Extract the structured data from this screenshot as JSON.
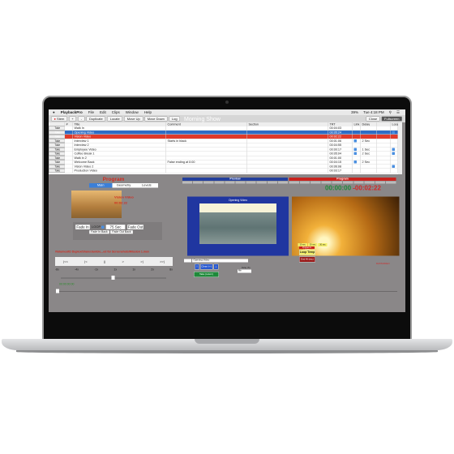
{
  "menubar": {
    "app": "PlaybackPro",
    "items": [
      "File",
      "Edit",
      "Clips",
      "Window",
      "Help"
    ],
    "battery": "39%",
    "clock": "Tue 4:18 PM"
  },
  "toolbar": {
    "items": [
      "Stem",
      "+",
      "-",
      "Duplicate",
      "Locate",
      "Move Up",
      "Move Down",
      "Log"
    ],
    "title": "Morning Show",
    "close": "Close",
    "fullscreen": "Fullscreen"
  },
  "table": {
    "headers": [
      "",
      "#",
      "Title",
      "Comment",
      "Section",
      "TRT",
      "Link",
      "Delay",
      "",
      "Loop"
    ],
    "take": "Take",
    "rows": [
      {
        "title": "Walk In",
        "comment": "",
        "trt": "00:04:03",
        "link": false,
        "delay": "",
        "loop": false
      },
      {
        "title": "Opening Video",
        "comment": "",
        "trt": "00:05:24",
        "link": false,
        "delay": "",
        "loop": true
      },
      {
        "title": "Vision Video",
        "comment": "",
        "trt": "00:02:22",
        "link": false,
        "delay": "",
        "loop": false
      },
      {
        "title": "Interview 1",
        "comment": "Starts in black",
        "trt": "00:01:06",
        "link": true,
        "delay": "2 Sec",
        "loop": false
      },
      {
        "title": "Interview 2",
        "comment": "",
        "trt": "00:04:55",
        "link": false,
        "delay": "",
        "loop": false
      },
      {
        "title": "Employee Video",
        "comment": "",
        "trt": "00:00:17",
        "link": true,
        "delay": "1 Sec",
        "loop": true
      },
      {
        "title": "Coffee Break 1",
        "comment": "",
        "trt": "00:05:04",
        "link": true,
        "delay": "2 Sec",
        "loop": true
      },
      {
        "title": "Walk in 2",
        "comment": "",
        "trt": "00:01:00",
        "link": false,
        "delay": "",
        "loop": false
      },
      {
        "title": "Welcome Back",
        "comment": "False ending at 0:00",
        "trt": "00:04:15",
        "link": true,
        "delay": "2 Sec",
        "loop": false
      },
      {
        "title": "Vision Video 2",
        "comment": "",
        "trt": "00:06:08",
        "link": false,
        "delay": "",
        "loop": true
      },
      {
        "title": "Production Video",
        "comment": "",
        "trt": "00:03:17",
        "link": false,
        "delay": "",
        "loop": false
      }
    ]
  },
  "program_panel": {
    "title": "Program",
    "tabs": [
      "Main",
      "Geometry",
      "Levels"
    ],
    "clip_name": "Vision Video",
    "clip_time": "00:02:22",
    "fade_in": "Fade In",
    "loop": "LOOP",
    "fade_time": "75 Sec",
    "fade_out": "Fade Out",
    "fade_in_back": "Fade In Back",
    "fade_out_back": "Fade Out Back",
    "path": "/Volumes/ID Duplex/Share/Jumble...ed for Screenshots/Mission 1.mov",
    "transport": [
      "|<<",
      "|<",
      "||",
      ">",
      ">|",
      ">>|"
    ],
    "speeds": [
      "-8x",
      "-4x",
      "-1x",
      "1x",
      "1x",
      "2x",
      "8x"
    ],
    "elapsed": "00:00:00:00"
  },
  "preview": {
    "label": "Preview",
    "clip": "Opening Video",
    "dropdown": "Opening Video",
    "up": "↑",
    "clear": "Clear (<-)",
    "down": "↓",
    "take": "Take (return)",
    "delay_label": "Delay (S)",
    "delay_value": "Min"
  },
  "program": {
    "label": "Program",
    "elapsed": "00:00:00",
    "remaining": "-00:02:22",
    "times": [
      "10 sec",
      "20 sec",
      "30 sec"
    ],
    "looping": "Program is Looping",
    "loop_temp": "Loop Temp",
    "end_all": "End All (esc)",
    "brand": "DATAVIDEO"
  }
}
